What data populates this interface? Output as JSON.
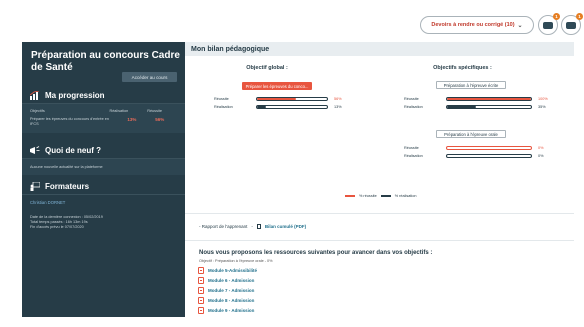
{
  "header": {
    "devoirs_label": "Devoirs à rendre ou corrigé (10)",
    "notif_count_1": "1",
    "notif_count_2": "1"
  },
  "sidebar": {
    "title": "Préparation au concours Cadre de Santé",
    "access_button": "Accéder au cours",
    "progression": {
      "heading": "Ma progression",
      "col_objectifs": "Objectifs",
      "col_realisation": "Réalisation",
      "col_reussite": "Réussite",
      "row_label": "Préparer les épreuves du concours d'entrée en IFCS",
      "row_realisation": "13%",
      "row_reussite": "56%"
    },
    "news": {
      "heading": "Quoi de neuf ?",
      "item": "Aucune nouvelle actualité sur la plateforme"
    },
    "trainers": {
      "heading": "Formateurs",
      "name": "Christian DORNET",
      "last_login": "Date de la dernière connexion : 05/02/2019",
      "time_spent": "Total temps passés : 16h 13m 19s",
      "end_date": "Fin d'accès prévu le 07/07/2020"
    }
  },
  "main": {
    "title": "Mon bilan pédagogique",
    "global": {
      "title": "Objectif global :",
      "objective": "Préparer les épreuves du conco...",
      "reussite_label": "Réussite",
      "reussite_value": "56%",
      "realisation_label": "Réalisation",
      "realisation_value": "13%"
    },
    "specific": {
      "title": "Objectifs spécifiques :",
      "items": [
        {
          "name": "Préparation à l'épreuve écrite",
          "reussite_label": "Réussite",
          "reussite_value": "100%",
          "realisation_label": "Réalisation",
          "realisation_value": "35%"
        },
        {
          "name": "Préparation à l'épreuve orale",
          "reussite_label": "Réussite",
          "reussite_value": "0%",
          "realisation_label": "Réalisation",
          "realisation_value": "0%"
        }
      ]
    },
    "legend": {
      "reussite": "% réussite",
      "realisation": "% réalisation"
    },
    "reports": {
      "rapport": "- Rapport de l'apprenant",
      "sep": "-",
      "bilan": "Bilan cumulé (PDF)"
    },
    "recommendations": {
      "title": "Nous vous proposons les ressources suivantes pour avancer dans vos objectifs :",
      "subtitle": "Objectif : Préparation à l'épreuve orale - 0%",
      "modules": [
        "Module 5-Admissibilité",
        "Module 6 - Admission",
        "Module 7 - Admission",
        "Module 8 - Admission",
        "Module 9 - Admission"
      ]
    }
  },
  "colors": {
    "sidebar_bg": "#263c47",
    "accent_orange": "#e8553f",
    "link_blue": "#1f6f8b",
    "realisation_dark": "#263c47"
  },
  "progress": {
    "global_reussite": 0.56,
    "global_realisation": 0.13,
    "ecrite_reussite": 1.0,
    "ecrite_realisation": 0.35,
    "orale_reussite": 0.0,
    "orale_realisation": 0.0
  }
}
